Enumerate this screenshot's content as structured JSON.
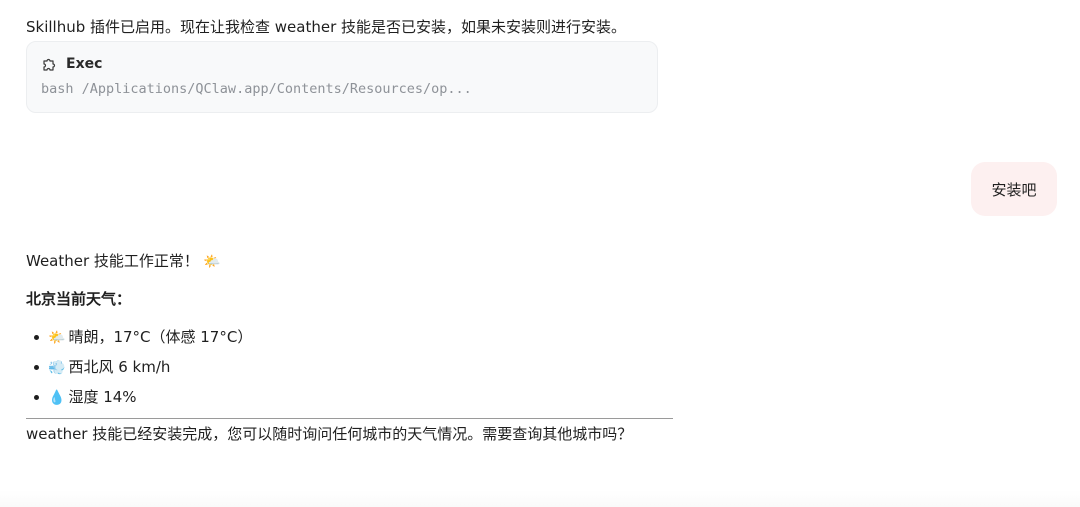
{
  "assistant_intro": "Skillhub 插件已启用。现在让我检查 weather 技能是否已安装，如果未安装则进行安装。",
  "tool_call": {
    "title": "Exec",
    "command": "bash /Applications/QClaw.app/Contents/Resources/op...",
    "icon": "puzzle-icon"
  },
  "user_message": "安装吧",
  "assistant_reply": {
    "status_text": "Weather 技能工作正常！",
    "status_emoji": "🌤️",
    "heading": "北京当前天气：",
    "weather_items": [
      {
        "emoji": "🌤️",
        "text": "晴朗，17°C（体感 17°C）"
      },
      {
        "emoji": "💨",
        "text": "西北风 6 km/h"
      },
      {
        "emoji": "💧",
        "text": "湿度 14%"
      }
    ],
    "closing": "weather 技能已经安装完成，您可以随时询问任何城市的天气情况。需要查询其他城市吗？"
  }
}
